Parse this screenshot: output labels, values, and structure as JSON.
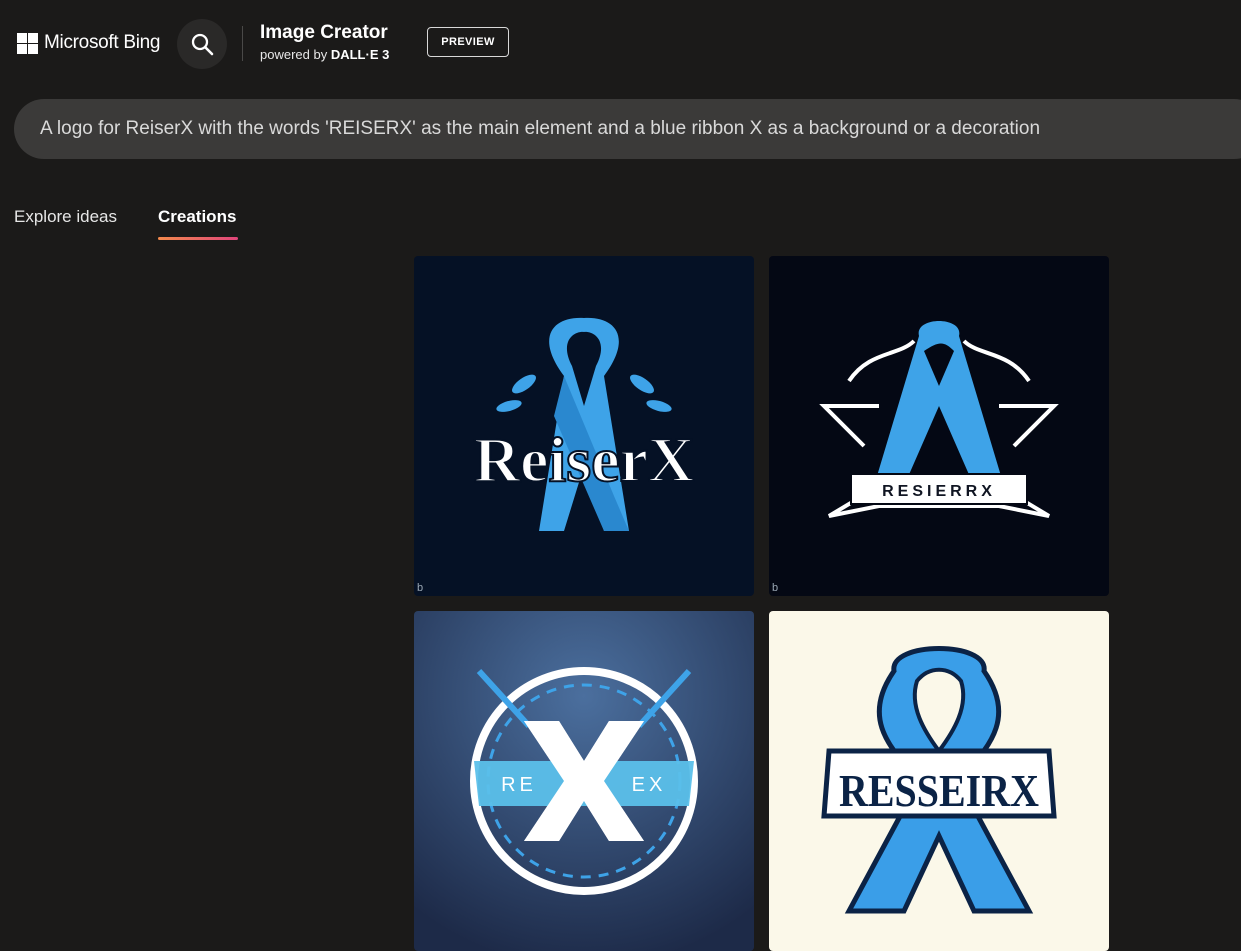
{
  "header": {
    "brand": "Microsoft Bing",
    "app_title": "Image Creator",
    "powered_by_prefix": "powered by",
    "powered_by_model": "DALL·E 3",
    "preview_badge": "PREVIEW",
    "search_icon": "search-icon",
    "logo_icon": "microsoft-logo-icon"
  },
  "prompt": {
    "text": "A logo for ReiserX with the words 'REISERX' as the main element and a blue ribbon X as a background or a decoration"
  },
  "tabs": [
    {
      "label": "Explore ideas",
      "active": false
    },
    {
      "label": "Creations",
      "active": true
    }
  ],
  "images": [
    {
      "name": "ReiserX logo with blue ribbon and leaves",
      "text": "ReiserX",
      "watermark": "b"
    },
    {
      "name": "Ornamental ribbon badge",
      "text": "RESIERRX",
      "watermark": "b"
    },
    {
      "name": "Circular X emblem",
      "text_left": "RE",
      "text_right": "EX"
    },
    {
      "name": "Ribbon with banner",
      "text": "RESSEIRX"
    }
  ],
  "colors": {
    "background": "#1b1a19",
    "prompt_bar": "#3b3a39",
    "tab_gradient_start": "#f48a4c",
    "tab_gradient_end": "#e0457b",
    "ribbon_blue": "#3ea3e8"
  }
}
